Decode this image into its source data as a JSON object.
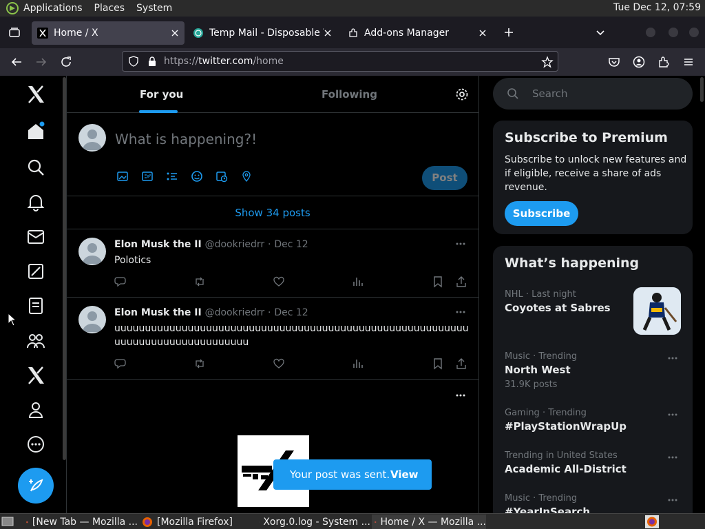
{
  "system_bar": {
    "menus": [
      "Applications",
      "Places",
      "System"
    ],
    "clock": "Tue Dec 12, 07:59"
  },
  "browser": {
    "tabs": [
      {
        "title": "Home / X",
        "active": true
      },
      {
        "title": "Temp Mail - Disposable Tem",
        "active": false
      },
      {
        "title": "Add-ons Manager",
        "active": false
      }
    ],
    "url_scheme": "https://",
    "url_host": "twitter.com",
    "url_path": "/home"
  },
  "feed": {
    "tab_for_you": "For you",
    "tab_following": "Following",
    "composer_placeholder": "What is happening?!",
    "post_button": "Post",
    "show_posts": "Show 34 posts",
    "tweets": [
      {
        "name": "Elon Musk the II",
        "handle": "@dookriedrr",
        "date": "Dec 12",
        "text": "Polotics"
      },
      {
        "name": "Elon Musk the II",
        "handle": "@dookriedrr",
        "date": "Dec 12",
        "text": "uuuuuuuuuuuuuuuuuuuuuuuuuuuuuuuuuuuuuuuuuuuuuuuuuuuuuuuuuuuuuuuuuuuuuuuuuuuuuuuu"
      }
    ]
  },
  "sidebar_right": {
    "search_placeholder": "Search",
    "premium": {
      "title": "Subscribe to Premium",
      "description": "Subscribe to unlock new features and if eligible, receive a share of ads revenue.",
      "button": "Subscribe"
    },
    "whats_happening": {
      "title": "What’s happening",
      "trends": [
        {
          "context": "NHL · Last night",
          "name": "Coyotes at Sabres",
          "count": ""
        },
        {
          "context": "Music · Trending",
          "name": "North West",
          "count": "31.9K posts"
        },
        {
          "context": "Gaming · Trending",
          "name": "#PlayStationWrapUp",
          "count": ""
        },
        {
          "context": "Trending in United States",
          "name": "Academic All-District",
          "count": ""
        },
        {
          "context": "Music · Trending",
          "name": "#YearInSearch",
          "count": ""
        }
      ]
    }
  },
  "toast": {
    "message": "Your post was sent.",
    "action": "View"
  },
  "taskbar": {
    "items": [
      {
        "title": "[New Tab — Mozilla ..."
      },
      {
        "title": "[Mozilla Firefox]"
      },
      {
        "title": "Xorg.0.log - System ..."
      },
      {
        "title": "Home / X — Mozilla ..."
      }
    ]
  },
  "colors": {
    "accent": "#1d9bf0",
    "background": "#000000",
    "card": "#16181c",
    "muted_text": "#71767b"
  }
}
